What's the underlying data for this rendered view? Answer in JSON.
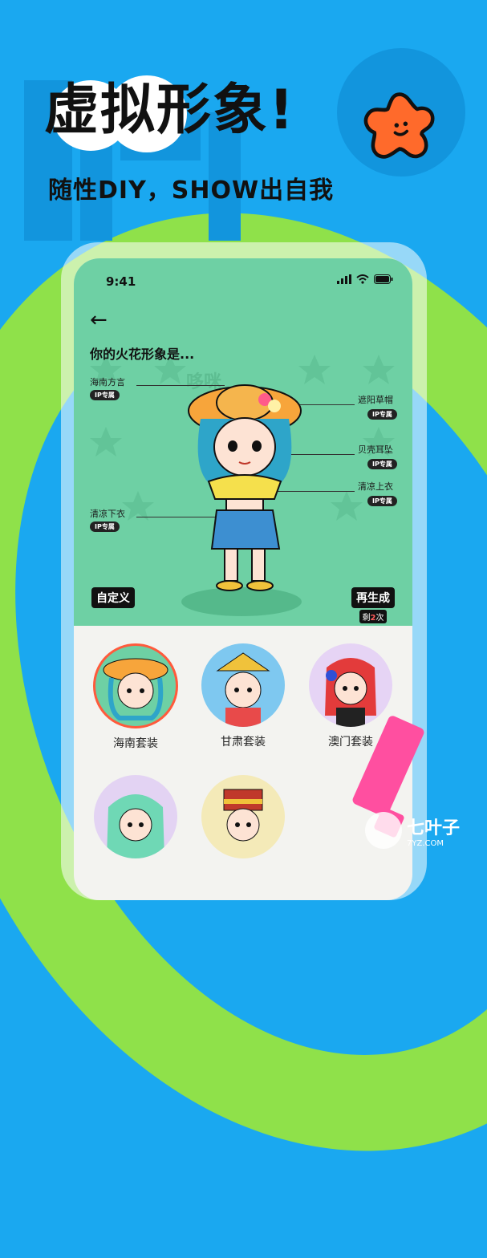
{
  "hero": {
    "title": "虚拟形象!",
    "subtitle": "随性DIY，SHOW出自我"
  },
  "status_bar": {
    "time": "9:41"
  },
  "scene": {
    "heading": "你的火花形象是...",
    "watermark_text": "哆咪",
    "labels": [
      {
        "text": "海南方言",
        "tag": "IP专属"
      },
      {
        "text": "遮阳草帽",
        "tag": "IP专属"
      },
      {
        "text": "贝壳耳坠",
        "tag": "IP专属"
      },
      {
        "text": "清凉上衣",
        "tag": "IP专属"
      },
      {
        "text": "清凉下衣",
        "tag": "IP专属"
      }
    ],
    "custom_button": "自定义",
    "regen_button": "再生成",
    "regen_prefix": "剩",
    "regen_count": "2",
    "regen_suffix": "次"
  },
  "outfits": [
    {
      "name": "海南套装",
      "selected": true
    },
    {
      "name": "甘肃套装",
      "selected": false
    },
    {
      "name": "澳门套装",
      "selected": false
    },
    {
      "name": "",
      "selected": false
    },
    {
      "name": "",
      "selected": false
    }
  ],
  "site_watermark": {
    "name": "七叶子",
    "url": "7YZ.COM"
  },
  "colors": {
    "background": "#1aa8f0",
    "accent_green": "#8fe14a",
    "scene_bg": "#6ed0a4",
    "blob_orange": "#ff6a2b",
    "pink": "#ff4fa0"
  }
}
